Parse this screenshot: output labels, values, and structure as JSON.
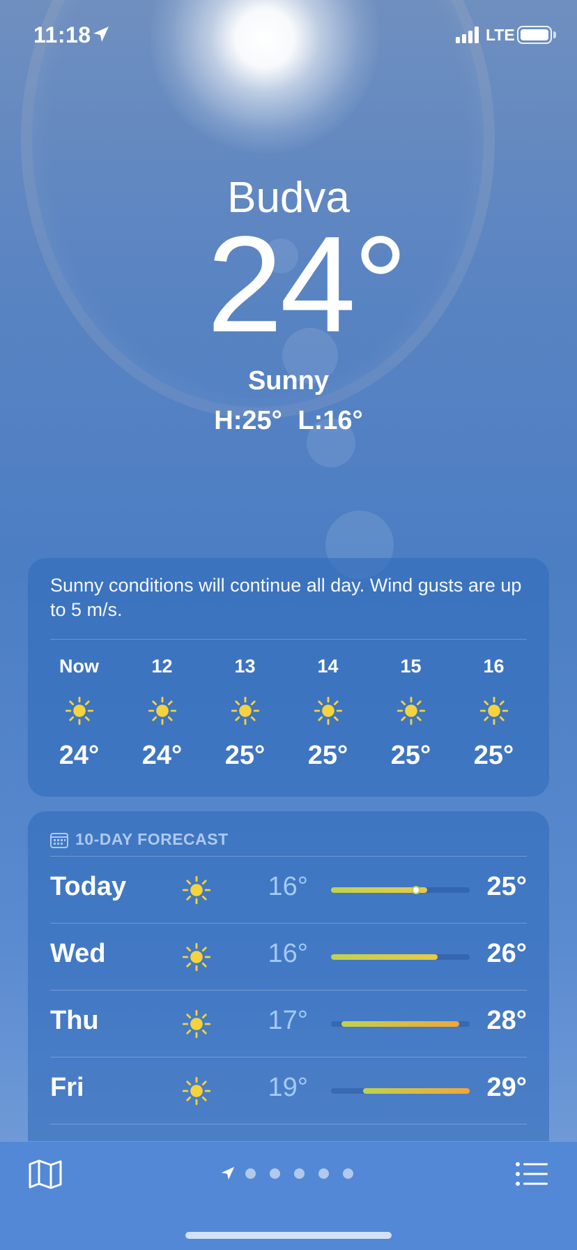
{
  "status_bar": {
    "time": "11:18",
    "network": "LTE"
  },
  "header": {
    "city": "Budva",
    "temperature": "24°",
    "condition": "Sunny",
    "high": "H:25°",
    "low": "L:16°"
  },
  "hourly": {
    "summary": "Sunny conditions will continue all day. Wind gusts are up to 5 m/s.",
    "hours": [
      {
        "label": "Now",
        "icon": "sun-icon",
        "temp": "24°"
      },
      {
        "label": "12",
        "icon": "sun-icon",
        "temp": "24°"
      },
      {
        "label": "13",
        "icon": "sun-icon",
        "temp": "25°"
      },
      {
        "label": "14",
        "icon": "sun-icon",
        "temp": "25°"
      },
      {
        "label": "15",
        "icon": "sun-icon",
        "temp": "25°"
      },
      {
        "label": "16",
        "icon": "sun-icon",
        "temp": "25°"
      }
    ]
  },
  "forecast": {
    "title": "10-DAY FORECAST",
    "range_min": 16,
    "range_max": 29,
    "days": [
      {
        "day": "Today",
        "icon": "sun-icon",
        "low": "16°",
        "high": "25°",
        "low_value": 16,
        "high_value": 25,
        "current_value": 24
      },
      {
        "day": "Wed",
        "icon": "sun-icon",
        "low": "16°",
        "high": "26°",
        "low_value": 16,
        "high_value": 26
      },
      {
        "day": "Thu",
        "icon": "sun-icon",
        "low": "17°",
        "high": "28°",
        "low_value": 17,
        "high_value": 28
      },
      {
        "day": "Fri",
        "icon": "sun-icon",
        "low": "19°",
        "high": "29°",
        "low_value": 19,
        "high_value": 29
      }
    ]
  },
  "tab_bar": {
    "page_dots": 5
  },
  "colors": {
    "sun": "#f6d33c",
    "bar_cool": "#bfd24e",
    "bar_warm": "#f0a63a",
    "tab_bar": "#5288d6"
  }
}
